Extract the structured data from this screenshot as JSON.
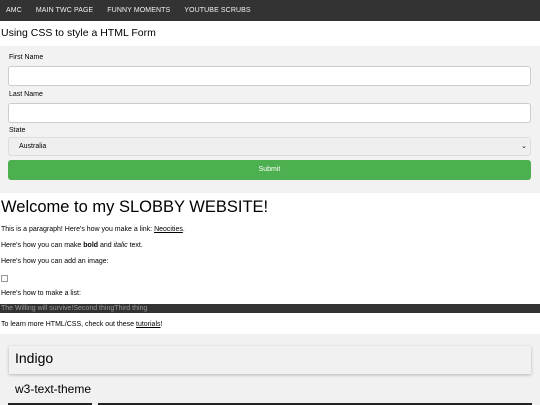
{
  "nav": {
    "items": [
      "AMC",
      "MAIN TWC PAGE",
      "FUNNY MOMENTS",
      "YOUTUBE SCRUBS"
    ]
  },
  "form": {
    "title": "Using CSS to style a HTML Form",
    "first_name_label": "First Name",
    "last_name_label": "Last Name",
    "state_label": "State",
    "state_value": "Australia",
    "submit_label": "Submit",
    "colors": {
      "submit_bg": "#4caf50",
      "form_bg": "#f2f2f2"
    }
  },
  "content": {
    "welcome": "Welcome to my SLOBBY WEBSITE!",
    "para1_text": "This is a paragraph! Here's how you make a link: ",
    "para1_link": "Neocities",
    "para1_end": ".",
    "para2_text": "Here's how you can make ",
    "para2_bold": "bold",
    "para2_mid": " and ",
    "para2_italic": "italic",
    "para2_end": " text.",
    "para3": "Here's how you can add an image:",
    "para4": "Here's how to make a list:",
    "list_items": [
      "The Willing will survive!",
      "Second thing",
      "Third thing"
    ],
    "learn_text": "To learn more HTML/CSS, check out these ",
    "learn_link": "tutorials",
    "learn_end": "!"
  },
  "theme": {
    "card_title": "Indigo",
    "subtitle": "w3-text-theme"
  },
  "colors": {
    "nav_bg": "#333333",
    "nav_text": "#f2f2f2"
  }
}
